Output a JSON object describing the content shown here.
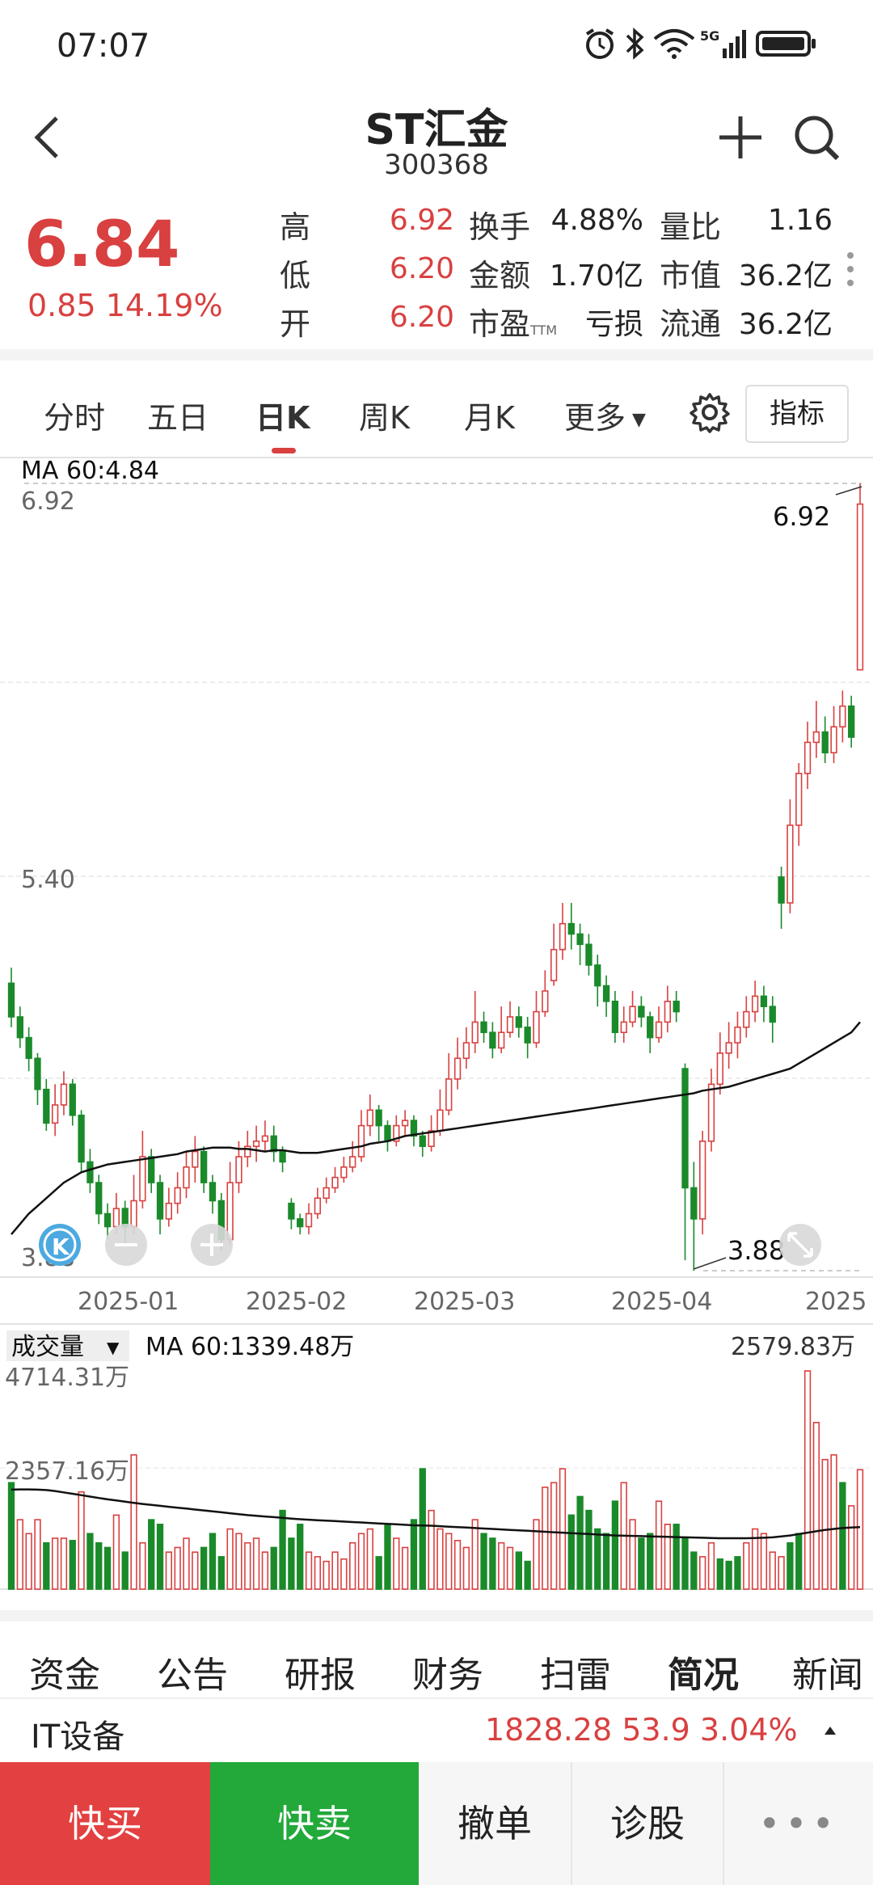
{
  "status_bar": {
    "time": "07:07"
  },
  "header": {
    "stock_name": "ST汇金",
    "stock_code": "300368"
  },
  "quote": {
    "price": "6.84",
    "change": "0.85  14.19%",
    "rows": [
      {
        "l1": "高",
        "v1": "6.92",
        "l2": "换手",
        "v2": "4.88%",
        "l3": "量比",
        "v3": "1.16"
      },
      {
        "l1": "低",
        "v1": "6.20",
        "l2": "金额",
        "v2": "1.70亿",
        "l3": "市值",
        "v3": "36.2亿"
      },
      {
        "l1": "开",
        "v1": "6.20",
        "l2": "市盈",
        "sup2": "TTM",
        "v2": "亏损",
        "l3": "流通",
        "v3": "36.2亿"
      }
    ]
  },
  "chart_tabs": [
    "分时",
    "五日",
    "日K",
    "周K",
    "月K",
    "更多"
  ],
  "active_tab": "日K",
  "indicator_label": "指标",
  "chart_data": {
    "type": "candlestick",
    "ma_label": "MA  60:4.84",
    "y_ticks": [
      "6.92",
      "5.40",
      "3.88"
    ],
    "ylim": [
      3.88,
      6.92
    ],
    "x_ticks": [
      "2025-01",
      "2025-02",
      "2025-03",
      "2025-04",
      "2025"
    ],
    "high_marker": "6.92",
    "low_marker": "3.88",
    "colors": {
      "up": "#d94040",
      "down": "#1a8a2a",
      "ma": "#111111"
    },
    "candles": [
      [
        4.99,
        4.86,
        5.05,
        4.82
      ],
      [
        4.86,
        4.78,
        4.9,
        4.74
      ],
      [
        4.78,
        4.7,
        4.82,
        4.65
      ],
      [
        4.7,
        4.58,
        4.72,
        4.52
      ],
      [
        4.58,
        4.45,
        4.62,
        4.42
      ],
      [
        4.45,
        4.52,
        4.6,
        4.4
      ],
      [
        4.52,
        4.6,
        4.65,
        4.48
      ],
      [
        4.6,
        4.48,
        4.62,
        4.44
      ],
      [
        4.48,
        4.3,
        4.5,
        4.26
      ],
      [
        4.3,
        4.22,
        4.35,
        4.18
      ],
      [
        4.22,
        4.1,
        4.25,
        4.06
      ],
      [
        4.1,
        4.05,
        4.14,
        4.0
      ],
      [
        4.05,
        4.12,
        4.18,
        4.02
      ],
      [
        4.12,
        4.05,
        4.15,
        3.98
      ],
      [
        4.05,
        4.15,
        4.25,
        4.02
      ],
      [
        4.15,
        4.32,
        4.42,
        4.12
      ],
      [
        4.32,
        4.22,
        4.35,
        4.18
      ],
      [
        4.22,
        4.08,
        4.25,
        4.02
      ],
      [
        4.08,
        4.14,
        4.2,
        4.05
      ],
      [
        4.14,
        4.2,
        4.26,
        4.1
      ],
      [
        4.2,
        4.28,
        4.34,
        4.16
      ],
      [
        4.28,
        4.34,
        4.4,
        4.22
      ],
      [
        4.34,
        4.22,
        4.36,
        4.18
      ],
      [
        4.22,
        4.15,
        4.25,
        4.1
      ],
      [
        4.15,
        4.0,
        4.18,
        3.96
      ],
      [
        4.0,
        4.22,
        4.3,
        3.98
      ],
      [
        4.22,
        4.32,
        4.38,
        4.18
      ],
      [
        4.32,
        4.36,
        4.42,
        4.28
      ],
      [
        4.36,
        4.38,
        4.44,
        4.3
      ],
      [
        4.38,
        4.4,
        4.46,
        4.34
      ],
      [
        4.4,
        4.34,
        4.44,
        4.3
      ],
      [
        4.34,
        4.3,
        4.36,
        4.26
      ],
      [
        4.14,
        4.08,
        4.16,
        4.04
      ],
      [
        4.08,
        4.05,
        4.1,
        4.02
      ],
      [
        4.05,
        4.1,
        4.14,
        4.02
      ],
      [
        4.1,
        4.16,
        4.2,
        4.08
      ],
      [
        4.16,
        4.2,
        4.24,
        4.14
      ],
      [
        4.2,
        4.24,
        4.28,
        4.18
      ],
      [
        4.24,
        4.28,
        4.32,
        4.22
      ],
      [
        4.28,
        4.32,
        4.38,
        4.26
      ],
      [
        4.32,
        4.44,
        4.5,
        4.3
      ],
      [
        4.44,
        4.5,
        4.56,
        4.4
      ],
      [
        4.5,
        4.44,
        4.52,
        4.38
      ],
      [
        4.44,
        4.38,
        4.46,
        4.34
      ],
      [
        4.38,
        4.44,
        4.48,
        4.36
      ],
      [
        4.44,
        4.46,
        4.5,
        4.4
      ],
      [
        4.46,
        4.4,
        4.48,
        4.36
      ],
      [
        4.4,
        4.36,
        4.42,
        4.32
      ],
      [
        4.36,
        4.42,
        4.48,
        4.34
      ],
      [
        4.42,
        4.5,
        4.58,
        4.4
      ],
      [
        4.5,
        4.62,
        4.72,
        4.48
      ],
      [
        4.62,
        4.7,
        4.78,
        4.58
      ],
      [
        4.7,
        4.76,
        4.82,
        4.66
      ],
      [
        4.76,
        4.84,
        4.96,
        4.72
      ],
      [
        4.84,
        4.8,
        4.88,
        4.76
      ],
      [
        4.8,
        4.74,
        4.84,
        4.7
      ],
      [
        4.74,
        4.8,
        4.9,
        4.72
      ],
      [
        4.8,
        4.86,
        4.92,
        4.78
      ],
      [
        4.86,
        4.82,
        4.9,
        4.78
      ],
      [
        4.82,
        4.76,
        4.86,
        4.7
      ],
      [
        4.76,
        4.88,
        4.96,
        4.74
      ],
      [
        4.88,
        4.96,
        5.04,
        4.86
      ],
      [
        5.0,
        5.12,
        5.22,
        4.98
      ],
      [
        5.12,
        5.22,
        5.3,
        5.08
      ],
      [
        5.22,
        5.18,
        5.3,
        5.12
      ],
      [
        5.18,
        5.14,
        5.22,
        5.06
      ],
      [
        5.14,
        5.06,
        5.18,
        5.02
      ],
      [
        5.06,
        4.98,
        5.1,
        4.9
      ],
      [
        4.98,
        4.92,
        5.02,
        4.86
      ],
      [
        4.92,
        4.8,
        4.96,
        4.76
      ],
      [
        4.8,
        4.84,
        4.9,
        4.76
      ],
      [
        4.84,
        4.9,
        4.96,
        4.82
      ],
      [
        4.9,
        4.86,
        4.94,
        4.82
      ],
      [
        4.86,
        4.78,
        4.88,
        4.72
      ],
      [
        4.78,
        4.84,
        4.9,
        4.76
      ],
      [
        4.84,
        4.92,
        4.98,
        4.8
      ],
      [
        4.92,
        4.88,
        4.96,
        4.84
      ],
      [
        4.66,
        4.2,
        4.68,
        3.92
      ],
      [
        4.2,
        4.08,
        4.3,
        3.88
      ],
      [
        4.08,
        4.38,
        4.42,
        4.02
      ],
      [
        4.38,
        4.6,
        4.66,
        4.34
      ],
      [
        4.6,
        4.72,
        4.8,
        4.56
      ],
      [
        4.72,
        4.76,
        4.84,
        4.66
      ],
      [
        4.76,
        4.82,
        4.88,
        4.7
      ],
      [
        4.82,
        4.88,
        4.94,
        4.78
      ],
      [
        4.88,
        4.94,
        5.0,
        4.84
      ],
      [
        4.94,
        4.9,
        4.98,
        4.84
      ],
      [
        4.9,
        4.84,
        4.94,
        4.76
      ],
      [
        5.4,
        5.3,
        5.44,
        5.2
      ],
      [
        5.3,
        5.6,
        5.7,
        5.26
      ],
      [
        5.6,
        5.8,
        5.84,
        5.52
      ],
      [
        5.8,
        5.92,
        6.0,
        5.74
      ],
      [
        5.92,
        5.96,
        6.08,
        5.86
      ],
      [
        5.96,
        5.88,
        6.02,
        5.84
      ],
      [
        5.88,
        5.98,
        6.06,
        5.84
      ],
      [
        5.98,
        6.06,
        6.12,
        5.92
      ],
      [
        6.06,
        5.94,
        6.1,
        5.9
      ],
      [
        6.2,
        6.84,
        6.92,
        6.2
      ]
    ],
    "ma_values": [
      4.02,
      4.06,
      4.1,
      4.13,
      4.16,
      4.19,
      4.22,
      4.24,
      4.26,
      4.27,
      4.28,
      4.29,
      4.295,
      4.3,
      4.305,
      4.31,
      4.315,
      4.32,
      4.325,
      4.33,
      4.34,
      4.345,
      4.35,
      4.355,
      4.355,
      4.355,
      4.35,
      4.35,
      4.345,
      4.34,
      4.345,
      4.345,
      4.34,
      4.335,
      4.335,
      4.335,
      4.34,
      4.345,
      4.35,
      4.355,
      4.36,
      4.37,
      4.375,
      4.38,
      4.39,
      4.4,
      4.405,
      4.41,
      4.415,
      4.42,
      4.425,
      4.43,
      4.435,
      4.44,
      4.445,
      4.45,
      4.455,
      4.46,
      4.465,
      4.47,
      4.475,
      4.48,
      4.485,
      4.49,
      4.495,
      4.5,
      4.505,
      4.51,
      4.515,
      4.52,
      4.525,
      4.53,
      4.535,
      4.54,
      4.545,
      4.55,
      4.555,
      4.56,
      4.565,
      4.575,
      4.58,
      4.585,
      4.59,
      4.6,
      4.61,
      4.62,
      4.63,
      4.64,
      4.65,
      4.66,
      4.68,
      4.7,
      4.72,
      4.74,
      4.76,
      4.78,
      4.8,
      4.84
    ],
    "volume": {
      "label": "成交量",
      "ma_label": "MA  60:1339.48万",
      "y_ticks": [
        "4714.31万",
        "2357.16万"
      ],
      "max_label": "2579.83万",
      "ylim": [
        0,
        4714.31
      ],
      "ma_values_wan": [
        2150,
        2155,
        2155,
        2150,
        2140,
        2120,
        2090,
        2060,
        2030,
        2000,
        1970,
        1940,
        1915,
        1890,
        1865,
        1840,
        1820,
        1800,
        1780,
        1760,
        1740,
        1720,
        1700,
        1680,
        1660,
        1640,
        1620,
        1600,
        1585,
        1570,
        1555,
        1540,
        1525,
        1510,
        1500,
        1490,
        1480,
        1470,
        1460,
        1450,
        1440,
        1430,
        1420,
        1410,
        1400,
        1390,
        1380,
        1375,
        1370,
        1360,
        1350,
        1340,
        1330,
        1320,
        1310,
        1300,
        1290,
        1280,
        1270,
        1260,
        1250,
        1240,
        1230,
        1220,
        1210,
        1200,
        1190,
        1180,
        1170,
        1160,
        1155,
        1150,
        1145,
        1140,
        1135,
        1130,
        1125,
        1120,
        1115,
        1110,
        1105,
        1100,
        1100,
        1100,
        1100,
        1105,
        1110,
        1120,
        1140,
        1160,
        1190,
        1220,
        1250,
        1280,
        1300,
        1320,
        1330,
        1339.48
      ],
      "values_wan": [
        2300,
        1500,
        1200,
        1500,
        1000,
        1100,
        1100,
        1050,
        2100,
        1200,
        1000,
        900,
        1600,
        800,
        2900,
        1000,
        1500,
        1400,
        800,
        900,
        1100,
        800,
        900,
        1200,
        700,
        1300,
        1200,
        1000,
        1100,
        800,
        900,
        1700,
        1100,
        1400,
        800,
        700,
        600,
        800,
        650,
        1000,
        1200,
        1300,
        700,
        1400,
        1100,
        900,
        1500,
        2600,
        1700,
        1300,
        1200,
        1050,
        900,
        1500,
        1200,
        1100,
        1000,
        900,
        800,
        600,
        1500,
        2200,
        2300,
        2600,
        1600,
        2000,
        1700,
        1300,
        1200,
        1900,
        2300,
        1500,
        1100,
        1200,
        1900,
        1400,
        1400,
        1100,
        800,
        700,
        1000,
        650,
        600,
        700,
        1000,
        1300,
        1200,
        800,
        700,
        1000,
        1200,
        4714,
        3600,
        2800,
        2900,
        2300,
        1800,
        2580
      ],
      "up_flags": [
        0,
        1,
        1,
        1,
        0,
        1,
        1,
        0,
        1,
        0,
        0,
        0,
        1,
        0,
        1,
        1,
        0,
        0,
        1,
        1,
        1,
        1,
        0,
        0,
        0,
        1,
        1,
        1,
        1,
        1,
        0,
        0,
        0,
        0,
        1,
        1,
        1,
        1,
        1,
        1,
        1,
        1,
        0,
        0,
        1,
        1,
        0,
        0,
        1,
        1,
        1,
        1,
        1,
        1,
        0,
        0,
        1,
        1,
        0,
        0,
        1,
        1,
        1,
        1,
        0,
        0,
        0,
        0,
        0,
        0,
        1,
        1,
        0,
        0,
        1,
        1,
        0,
        0,
        0,
        1,
        1,
        0,
        0,
        0,
        1,
        1,
        1,
        1,
        1,
        0,
        0,
        1,
        1,
        1,
        1,
        0,
        1,
        1
      ]
    }
  },
  "bottom_tabs": [
    "资金",
    "公告",
    "研报",
    "财务",
    "扫雷",
    "简况",
    "新闻"
  ],
  "active_bottom_tab": "简况",
  "industry": {
    "label": "IT设备",
    "values": "1828.28  53.9  3.04%"
  },
  "action_bar": {
    "buy": "快买",
    "sell": "快卖",
    "cancel": "撤单",
    "diagnose": "诊股",
    "more": "•••"
  }
}
